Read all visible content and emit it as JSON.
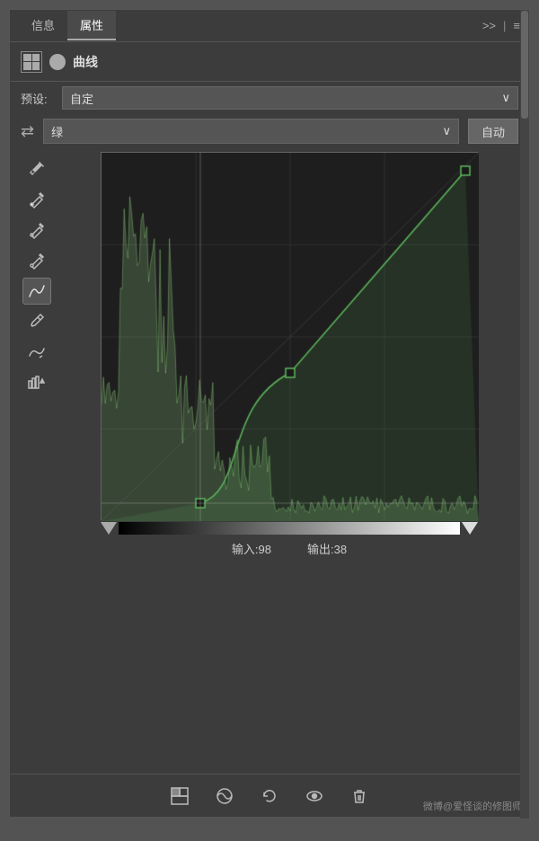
{
  "tabs": {
    "info": "信息",
    "properties": "属性",
    "active": "属性"
  },
  "tab_actions": {
    "expand": ">>",
    "menu": "≡"
  },
  "curve_title": {
    "label": "曲线"
  },
  "preset": {
    "label": "预设:",
    "value": "自定",
    "arrow": "∨"
  },
  "channel": {
    "value": "绿",
    "arrow": "∨",
    "auto_btn": "自动",
    "channel_icon": "⇄"
  },
  "io": {
    "input_label": "输入:98",
    "output_label": "输出:38"
  },
  "bottom_tools": {
    "stamp": "◧",
    "eye_circle": "◎",
    "undo": "↺",
    "eye": "👁",
    "trash": "🗑"
  },
  "watermark": "微博@爱怪谈的修图师",
  "colors": {
    "accent_green": "#7FBA00",
    "curve_green": "#5CB85C",
    "bg_dark": "#1a1a1a",
    "bg_panel": "#3c3c3c",
    "grid": "#2a2a2a"
  }
}
